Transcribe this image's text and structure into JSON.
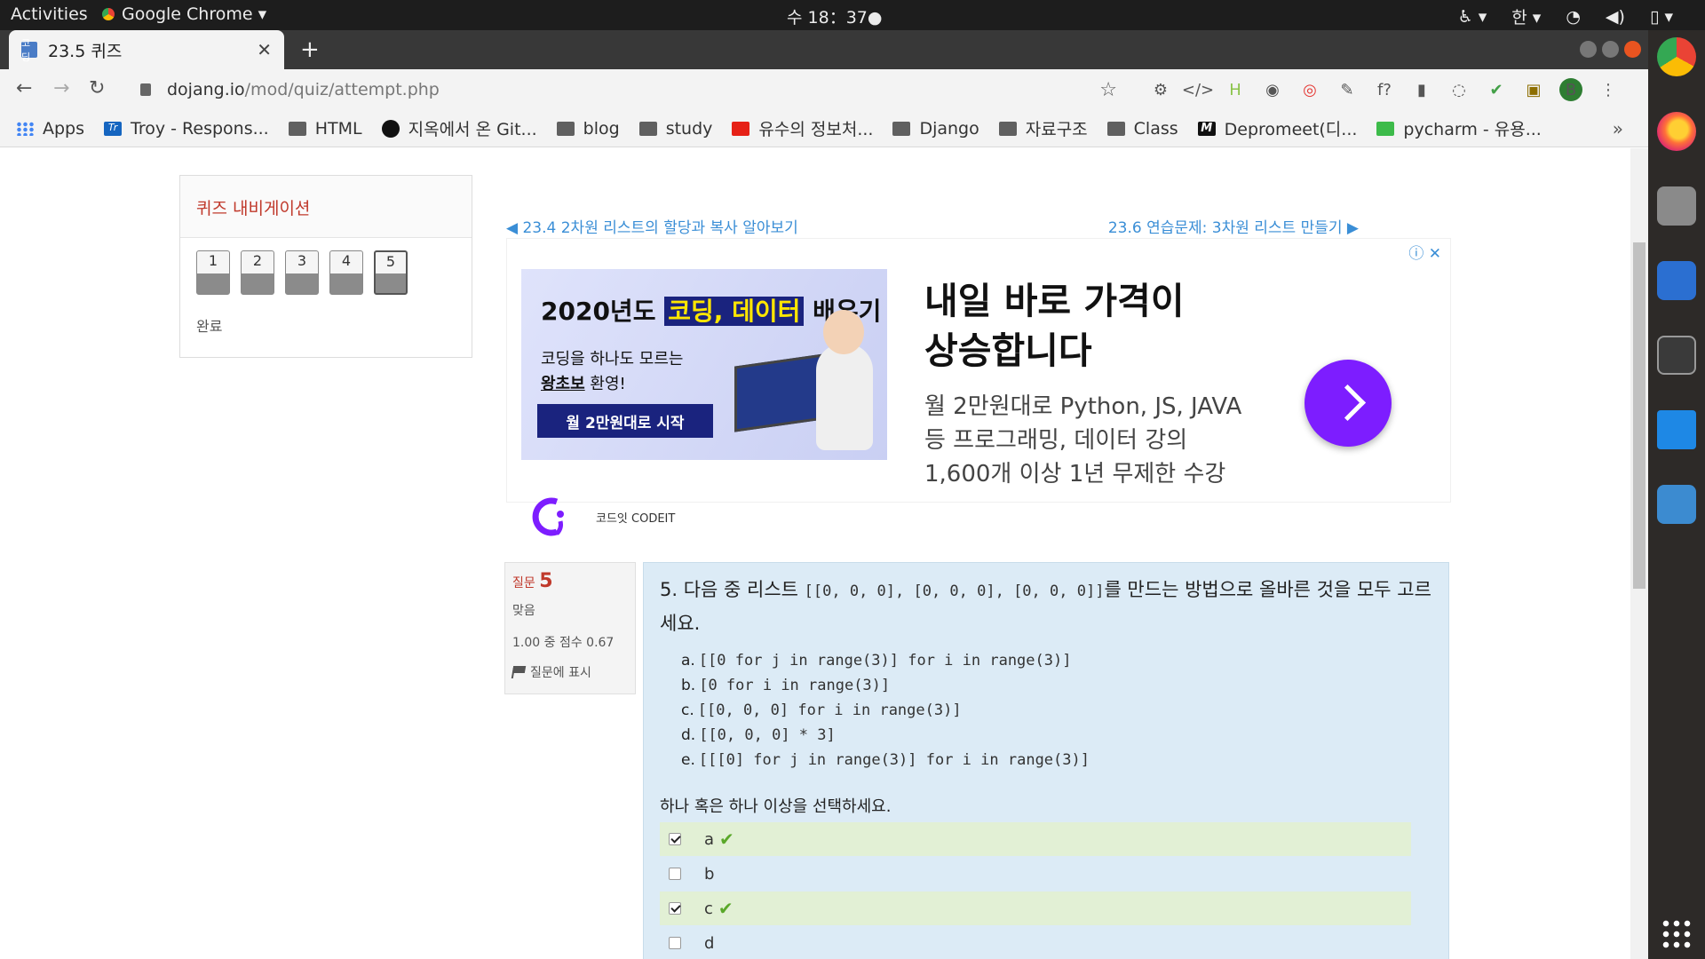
{
  "topbar": {
    "activities": "Activities",
    "app": "Google Chrome ▾",
    "clock": "수 18：37●",
    "ime": "한 ▾"
  },
  "tab": {
    "favicon": "코딩",
    "title": "23.5 퀴즈",
    "close": "✕",
    "new": "+"
  },
  "toolbar": {
    "back": "←",
    "forward": "→",
    "reload": "↻",
    "host": "dojang.io",
    "path": "/mod/quiz/attempt.php",
    "star": "☆",
    "avatar": "B",
    "menu": "⋮",
    "extensions": [
      "⚙",
      "</>",
      "H",
      "◉",
      "◎",
      "✎",
      "f?",
      "▮",
      "◌",
      "✔",
      "▣"
    ]
  },
  "bookmarks": [
    {
      "label": "Apps",
      "icon": "apps-grid-icon"
    },
    {
      "label": "Troy - Respons...",
      "icon": "trello-icon"
    },
    {
      "label": "HTML",
      "icon": "folder-icon"
    },
    {
      "label": "지옥에서 온 Git...",
      "icon": "github-icon"
    },
    {
      "label": "blog",
      "icon": "folder-icon"
    },
    {
      "label": "study",
      "icon": "folder-icon"
    },
    {
      "label": "유수의 정보처...",
      "icon": "youtube-icon"
    },
    {
      "label": "Django",
      "icon": "folder-icon"
    },
    {
      "label": "자료구조",
      "icon": "folder-icon"
    },
    {
      "label": "Class",
      "icon": "folder-icon"
    },
    {
      "label": "Depromeet(디...",
      "icon": "medium-icon"
    },
    {
      "label": "pycharm - 유용...",
      "icon": "sheet-icon"
    }
  ],
  "bookmarks_more": "»",
  "quiznav": {
    "title": "퀴즈 내비게이션",
    "buttons": [
      "1",
      "2",
      "3",
      "4",
      "5"
    ],
    "current": "5",
    "finish": "완료"
  },
  "pagination": {
    "prev": "◀ 23.4 2차원 리스트의 할당과 복사 알아보기",
    "next": "23.6 연습문제: 3차원 리스트 만들기 ▶"
  },
  "ad": {
    "choices": "ⓘ ✕",
    "banner_line1_pre": "2020년도 ",
    "banner_line1_hl": "코딩, 데이터",
    "banner_line1_post": " 배우기",
    "banner_line2": "코딩을 하나도 모르는",
    "banner_line3_b": "왕초보",
    "banner_line3_rest": " 환영!",
    "banner_cta": "월 2만원대로 시작",
    "brand": "코드잇 CODEIT",
    "headline": "내일 바로 가격이 상승합니다",
    "body": "월 2만원대로 Python, JS, JAVA 등 프로그래밍, 데이터 강의 1,600개 이상 1년 무제한 수강"
  },
  "question": {
    "label": "질문",
    "number": "5",
    "state": "맞음",
    "grade": "1.00 중 점수 0.67",
    "flag": "질문에 표시",
    "text_pre": "5. 다음 중 리스트 ",
    "text_code": "[[0, 0, 0], [0, 0, 0], [0, 0, 0]]",
    "text_post": "를 만드는 방법으로 올바른 것을 모두 고르세요.",
    "options": [
      {
        "letter": "a.",
        "code": "[[0 for j in range(3)] for i in range(3)]"
      },
      {
        "letter": "b.",
        "code": "[0 for i in range(3)]"
      },
      {
        "letter": "c.",
        "code": "[[0, 0, 0] for i in range(3)]"
      },
      {
        "letter": "d.",
        "code": "[[0, 0, 0] * 3]"
      },
      {
        "letter": "e.",
        "code": "[[[0] for j in range(3)] for i in range(3)]"
      }
    ],
    "prompt": "하나 혹은 하나 이상을 선택하세요.",
    "answers": [
      {
        "label": "a",
        "checked": true,
        "correct": true
      },
      {
        "label": "b",
        "checked": false,
        "correct": false
      },
      {
        "label": "c",
        "checked": true,
        "correct": true
      },
      {
        "label": "d",
        "checked": false,
        "correct": false
      }
    ]
  }
}
